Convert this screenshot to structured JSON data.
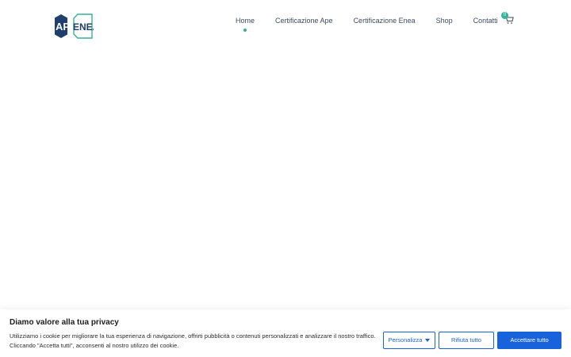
{
  "logo": {
    "part1": "AP",
    "part2": "ENEA"
  },
  "nav": {
    "items": [
      {
        "label": "Home",
        "active": true
      },
      {
        "label": "Certificazione Ape",
        "active": false
      },
      {
        "label": "Certificazione Enea",
        "active": false
      },
      {
        "label": "Shop",
        "active": false
      },
      {
        "label": "Contatti",
        "active": false
      }
    ]
  },
  "cart": {
    "count": "0",
    "icon": "cart-icon"
  },
  "cookie": {
    "title": "Diamo valore alla tua privacy",
    "text_line1": "Utilizziamo i cookie per migliorare la tua esperienza di navigazione, offrirti pubblicità o contenuti personalizzati e analizzare il nostro traffico.",
    "text_line2": "Cliccando \"Accetta tutti\", acconsenti al nostro utilizzo dei cookie.",
    "personalizza_label": "Personalizza",
    "rifiuta_label": "Rifiuta tutto",
    "accetta_label": "Accettare tutto"
  },
  "colors": {
    "accent": "#2fb39a",
    "brand_navy": "#1f3f6e",
    "button_blue": "#1863dc"
  }
}
